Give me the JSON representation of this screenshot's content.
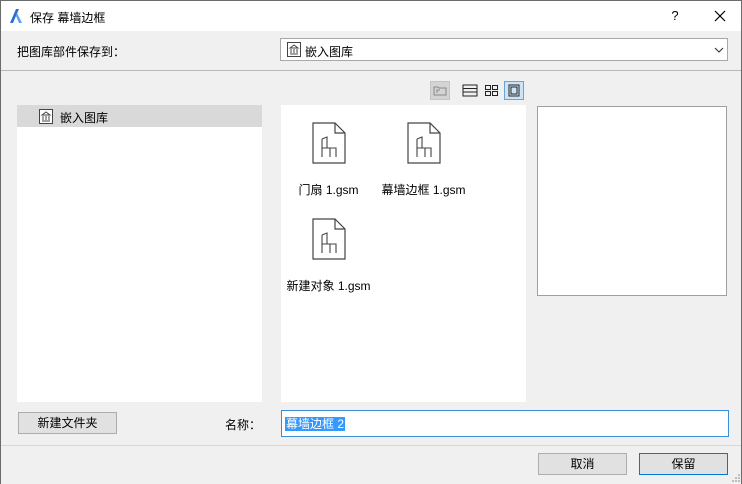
{
  "window": {
    "title": "保存 幕墙边框",
    "help": "?"
  },
  "save_to": {
    "label": "把图库部件保存到：",
    "selected": "嵌入图库"
  },
  "tree": {
    "items": [
      {
        "label": "嵌入图库"
      }
    ]
  },
  "files": [
    {
      "name": "门扇 1.gsm"
    },
    {
      "name": "幕墙边框 1.gsm"
    },
    {
      "name": "新建对象 1.gsm"
    }
  ],
  "footer": {
    "new_folder": "新建文件夹",
    "name_label": "名称：",
    "name_value": "幕墙边框 2",
    "cancel": "取消",
    "save": "保留"
  },
  "colors": {
    "accent": "#3399ff",
    "selection": "#d9d9d9"
  },
  "icons": [
    "app-logo-icon",
    "close-icon",
    "library-icon",
    "chevron-down-icon",
    "folder-up-icon",
    "list-view-icon",
    "grid-view-icon",
    "large-view-icon",
    "object-file-icon"
  ]
}
